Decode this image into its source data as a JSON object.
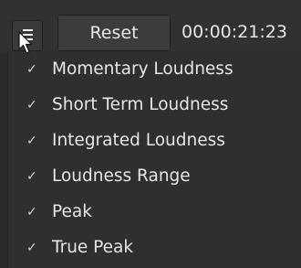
{
  "toolbar": {
    "menu_icon": "hamburger-menu-icon",
    "reset_label": "Reset",
    "timecode": "00:00:21:23"
  },
  "menu": {
    "items": [
      {
        "label": "Momentary Loudness",
        "checked": true
      },
      {
        "label": "Short Term Loudness",
        "checked": true
      },
      {
        "label": "Integrated Loudness",
        "checked": true
      },
      {
        "label": "Loudness Range",
        "checked": true
      },
      {
        "label": "Peak",
        "checked": true
      },
      {
        "label": "True Peak",
        "checked": true
      }
    ],
    "check_glyph": "✓"
  }
}
